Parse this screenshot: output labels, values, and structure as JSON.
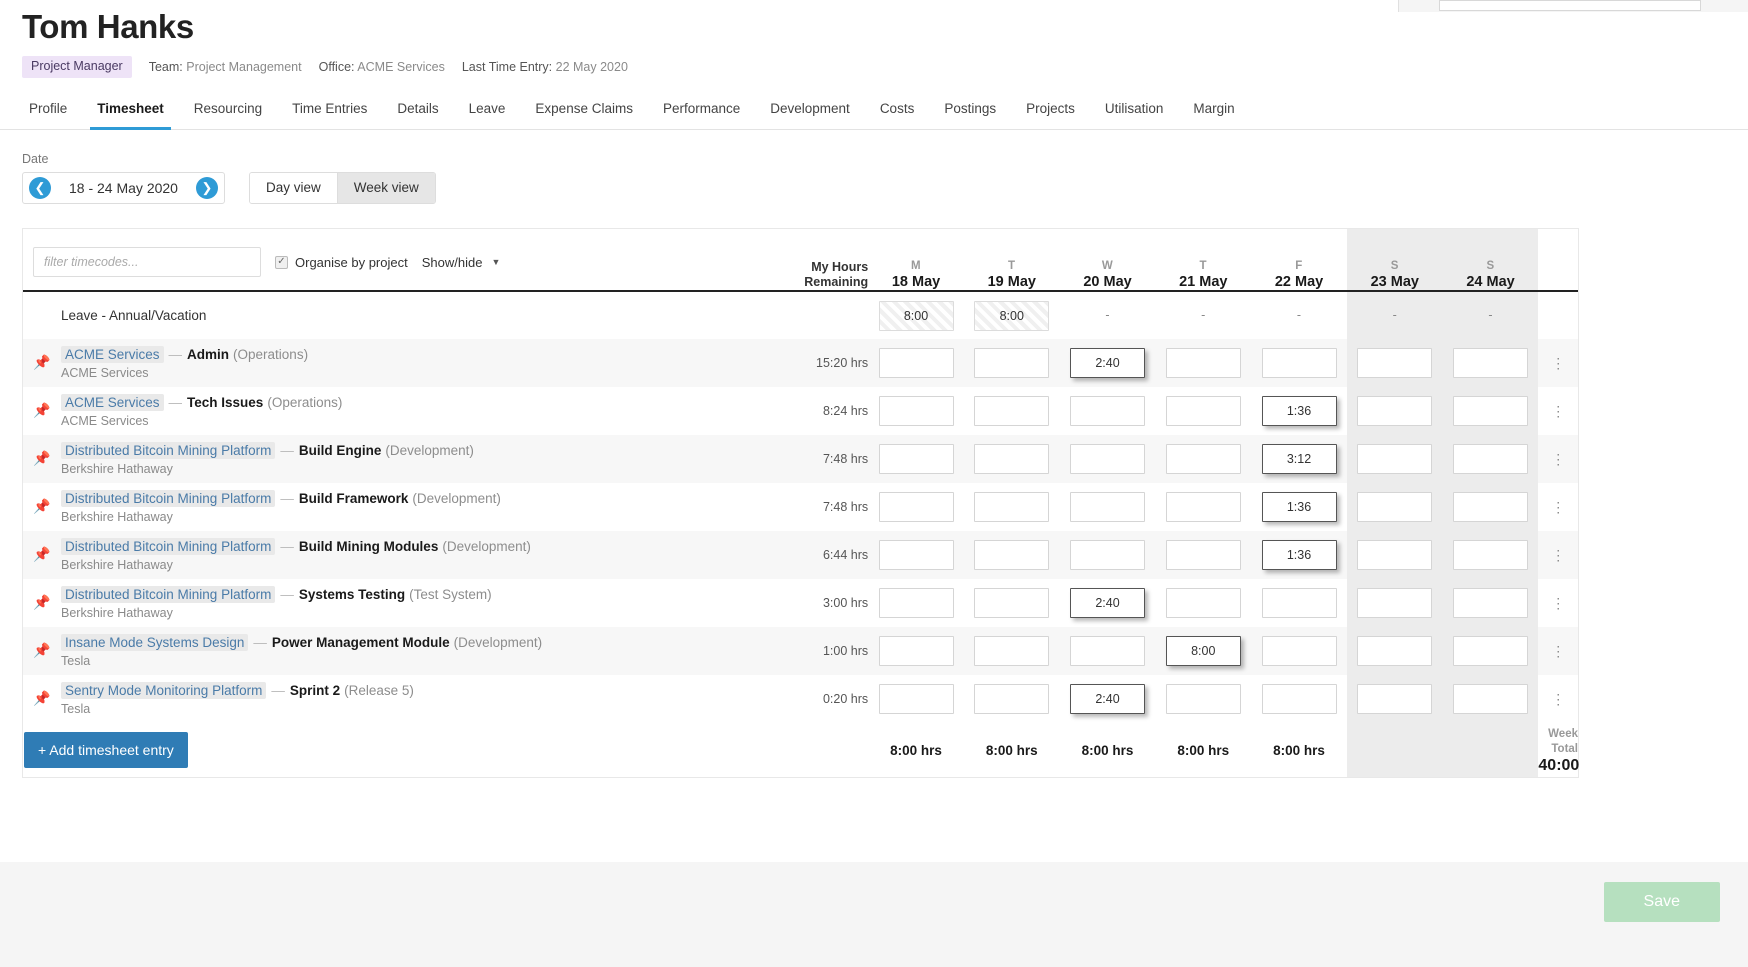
{
  "header": {
    "person_name": "Tom Hanks",
    "role_badge": "Project Manager",
    "team_label": "Team:",
    "team_value": "Project Management",
    "office_label": "Office:",
    "office_value": "ACME Services",
    "last_entry_label": "Last Time Entry:",
    "last_entry_value": "22 May 2020"
  },
  "tabs": [
    {
      "label": "Profile",
      "active": false
    },
    {
      "label": "Timesheet",
      "active": true
    },
    {
      "label": "Resourcing",
      "active": false
    },
    {
      "label": "Time Entries",
      "active": false
    },
    {
      "label": "Details",
      "active": false
    },
    {
      "label": "Leave",
      "active": false
    },
    {
      "label": "Expense Claims",
      "active": false
    },
    {
      "label": "Performance",
      "active": false
    },
    {
      "label": "Development",
      "active": false
    },
    {
      "label": "Costs",
      "active": false
    },
    {
      "label": "Postings",
      "active": false
    },
    {
      "label": "Projects",
      "active": false
    },
    {
      "label": "Utilisation",
      "active": false
    },
    {
      "label": "Margin",
      "active": false
    }
  ],
  "datebar": {
    "label": "Date",
    "range": "18 - 24 May 2020",
    "prev_icon": "arrow-left-icon",
    "next_icon": "arrow-right-icon",
    "day_view": "Day view",
    "week_view": "Week view",
    "active_view": "Week view"
  },
  "toolbar": {
    "filter_placeholder": "filter timecodes...",
    "filter_value": "",
    "organise_label": "Organise by project",
    "organise_checked": true,
    "showhide_label": "Show/hide",
    "caret_icon": "chevron-down-icon"
  },
  "columns": {
    "my_hours_line1": "My Hours",
    "my_hours_line2": "Remaining",
    "days": [
      {
        "dow": "M",
        "date": "18 May",
        "weekend": false
      },
      {
        "dow": "T",
        "date": "19 May",
        "weekend": false
      },
      {
        "dow": "W",
        "date": "20 May",
        "weekend": false
      },
      {
        "dow": "T",
        "date": "21 May",
        "weekend": false
      },
      {
        "dow": "F",
        "date": "22 May",
        "weekend": false
      },
      {
        "dow": "S",
        "date": "23 May",
        "weekend": true
      },
      {
        "dow": "S",
        "date": "24 May",
        "weekend": true
      }
    ]
  },
  "leave_row": {
    "label": "Leave - Annual/Vacation",
    "cells": [
      "8:00",
      "8:00",
      "-",
      "-",
      "-",
      "-",
      "-"
    ],
    "cell_types": [
      "hatch",
      "hatch",
      "dash",
      "dash",
      "dash",
      "dash",
      "dash"
    ]
  },
  "rows": [
    {
      "pin_icon": "pin-icon",
      "project": "ACME Services",
      "task": "Admin",
      "category": "(Operations)",
      "client": "ACME Services",
      "remaining": "15:20 hrs",
      "cells": [
        "",
        "",
        "2:40",
        "",
        "",
        "",
        ""
      ],
      "filled": [
        false,
        false,
        true,
        false,
        false,
        false,
        false
      ],
      "menu_icon": "kebab-menu-icon",
      "menu_highlight": false
    },
    {
      "pin_icon": "pin-icon",
      "project": "ACME Services",
      "task": "Tech Issues",
      "category": "(Operations)",
      "client": "ACME Services",
      "remaining": "8:24 hrs",
      "cells": [
        "",
        "",
        "",
        "",
        "1:36",
        "",
        ""
      ],
      "filled": [
        false,
        false,
        false,
        false,
        true,
        false,
        false
      ],
      "menu_icon": "kebab-menu-icon",
      "menu_highlight": false
    },
    {
      "pin_icon": "pin-icon",
      "project": "Distributed Bitcoin Mining Platform",
      "task": "Build Engine",
      "category": "(Development)",
      "client": "Berkshire Hathaway",
      "remaining": "7:48 hrs",
      "cells": [
        "",
        "",
        "",
        "",
        "3:12",
        "",
        ""
      ],
      "filled": [
        false,
        false,
        false,
        false,
        true,
        false,
        false
      ],
      "menu_icon": "kebab-menu-icon",
      "menu_highlight": true
    },
    {
      "pin_icon": "pin-icon",
      "project": "Distributed Bitcoin Mining Platform",
      "task": "Build Framework",
      "category": "(Development)",
      "client": "Berkshire Hathaway",
      "remaining": "7:48 hrs",
      "cells": [
        "",
        "",
        "",
        "",
        "1:36",
        "",
        ""
      ],
      "filled": [
        false,
        false,
        false,
        false,
        true,
        false,
        false
      ],
      "menu_icon": "kebab-menu-icon",
      "menu_highlight": false
    },
    {
      "pin_icon": "pin-icon",
      "project": "Distributed Bitcoin Mining Platform",
      "task": "Build Mining Modules",
      "category": "(Development)",
      "client": "Berkshire Hathaway",
      "remaining": "6:44 hrs",
      "cells": [
        "",
        "",
        "",
        "",
        "1:36",
        "",
        ""
      ],
      "filled": [
        false,
        false,
        false,
        false,
        true,
        false,
        false
      ],
      "menu_icon": "kebab-menu-icon",
      "menu_highlight": false
    },
    {
      "pin_icon": "pin-icon",
      "project": "Distributed Bitcoin Mining Platform",
      "task": "Systems Testing",
      "category": "(Test System)",
      "client": "Berkshire Hathaway",
      "remaining": "3:00 hrs",
      "cells": [
        "",
        "",
        "2:40",
        "",
        "",
        "",
        ""
      ],
      "filled": [
        false,
        false,
        true,
        false,
        false,
        false,
        false
      ],
      "menu_icon": "kebab-menu-icon",
      "menu_highlight": false
    },
    {
      "pin_icon": "pin-icon",
      "project": "Insane Mode Systems Design",
      "task": "Power Management Module",
      "category": "(Development)",
      "client": "Tesla",
      "remaining": "1:00 hrs",
      "cells": [
        "",
        "",
        "",
        "8:00",
        "",
        "",
        ""
      ],
      "filled": [
        false,
        false,
        false,
        true,
        false,
        false,
        false
      ],
      "menu_icon": "kebab-menu-icon",
      "menu_highlight": false
    },
    {
      "pin_icon": "pin-icon",
      "project": "Sentry Mode Monitoring Platform",
      "task": "Sprint 2",
      "category": "(Release 5)",
      "client": "Tesla",
      "remaining": "0:20 hrs",
      "cells": [
        "",
        "",
        "2:40",
        "",
        "",
        "",
        ""
      ],
      "filled": [
        false,
        false,
        true,
        false,
        false,
        false,
        false
      ],
      "menu_icon": "kebab-menu-icon",
      "menu_highlight": false
    }
  ],
  "totals": {
    "add_entry_label": "+ Add timesheet entry",
    "day_totals": [
      "8:00 hrs",
      "8:00 hrs",
      "8:00 hrs",
      "8:00 hrs",
      "8:00 hrs",
      "",
      ""
    ],
    "week_total_label": "Week Total",
    "week_total_value": "40:00"
  },
  "footer": {
    "save_label": "Save"
  },
  "colors": {
    "accent_blue": "#2e9bd6",
    "button_blue": "#2f7cb5",
    "save_green": "#b6e0bf",
    "badge_purple": "#eee3f7",
    "project_link": "#4a7ba8"
  }
}
